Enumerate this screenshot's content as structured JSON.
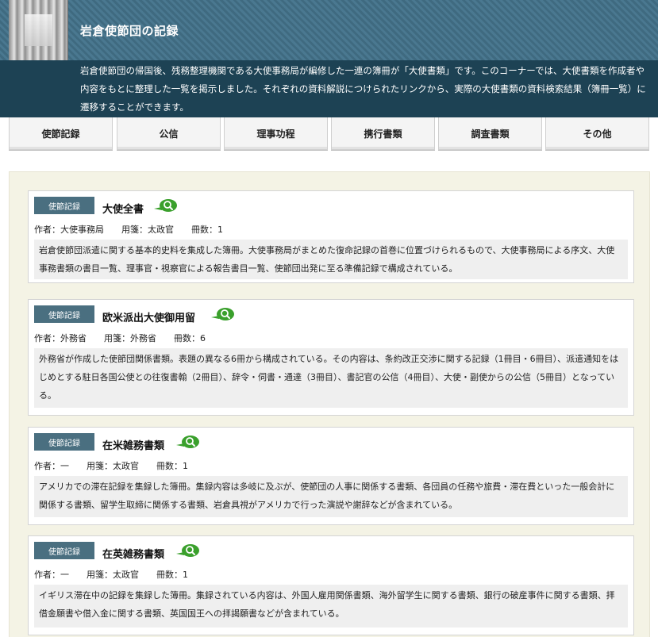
{
  "header": {
    "title": "岩倉使節団の記録",
    "description": "岩倉使節団の帰国後、残務整理機関である大使事務局が編修した一連の簿冊が「大使書類」です。このコーナーでは、大使書類を作成者や内容をもとに整理した一覧を掲示しました。それぞれの資料解説につけられたリンクから、実際の大使書類の資料検索結果（簿冊一覧）に遷移することができます。"
  },
  "tabs": [
    {
      "label": "使節記録"
    },
    {
      "label": "公信"
    },
    {
      "label": "理事功程"
    },
    {
      "label": "携行書類"
    },
    {
      "label": "調査書類"
    },
    {
      "label": "その他"
    }
  ],
  "records": [
    {
      "badge": "使節記録",
      "title": "大使全書",
      "meta": "作者：大使事務局　　用箋：太政官　　冊数：1",
      "description": "岩倉使節団派遣に関する基本的史料を集成した簿冊。大使事務局がまとめた復命記録の首巻に位置づけられるもので、大使事務局による序文、大使事務書類の書目一覧、理事官・視察官による報告書目一覧、使節団出発に至る準備記録で構成されている。"
    },
    {
      "badge": "使節記録",
      "title": "欧米派出大使御用留",
      "meta": "作者：外務省　　用箋：外務省　　冊数：6",
      "description": "外務省が作成した使節団関係書類。表題の異なる6冊から構成されている。その内容は、条約改正交渉に関する記録（1冊目・6冊目）、派遣通知をはじめとする駐日各国公使との往復書翰（2冊目）、辞令・伺書・通達（3冊目）、書記官の公信（4冊目）、大使・副使からの公信（5冊目）となっている。"
    },
    {
      "badge": "使節記録",
      "title": "在米雑務書類",
      "meta": "作者：一　　用箋：太政官　　冊数：1",
      "description": "アメリカでの滞在記録を集録した簿冊。集録内容は多岐に及ぶが、使節団の人事に関係する書類、各団員の任務や旅費・滞在費といった一般会計に関係する書類、留学生取締に関係する書類、岩倉具視がアメリカで行った演説や謝辞などが含まれている。"
    },
    {
      "badge": "使節記録",
      "title": "在英雑務書類",
      "meta": "作者：一　　用箋：太政官　　冊数：1",
      "description": "イギリス滞在中の記録を集録した簿冊。集録されている内容は、外国人雇用関係書類、海外留学生に関する書類、銀行の破産事件に関する書類、拝借金願書や借入金に関する書類、英国国王への拝謁願書などが含まれている。"
    }
  ],
  "colors": {
    "header_band": "#1d4254",
    "badge": "#4a6f80",
    "content_bg": "#f4f3e5",
    "search_icon": "#3aa02c"
  }
}
